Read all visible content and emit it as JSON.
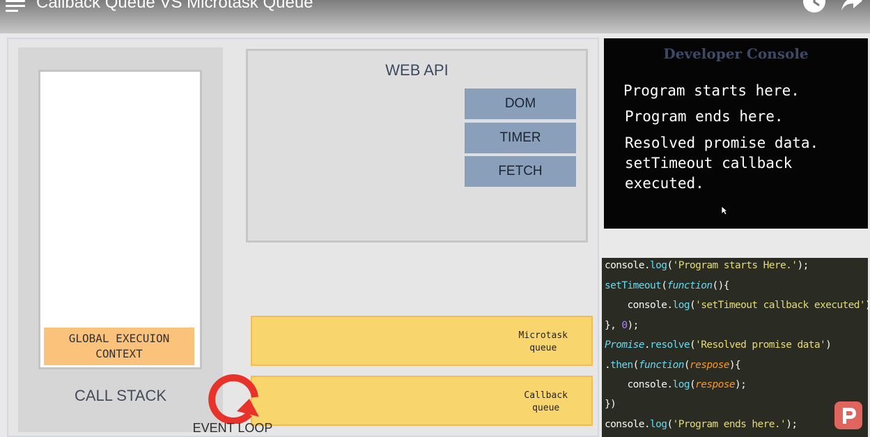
{
  "video": {
    "title": "Callback Queue VS Microtask Queue"
  },
  "call_stack": {
    "frame": [
      "GLOBAL EXECUION",
      "CONTEXT"
    ],
    "label": "CALL STACK"
  },
  "web_api": {
    "title": "WEB API",
    "buttons": [
      "DOM",
      "TIMER",
      "FETCH"
    ]
  },
  "queues": {
    "microtask": [
      "Microtask",
      "queue"
    ],
    "callback": [
      "Callback",
      "queue"
    ]
  },
  "event_loop": {
    "label": "EVENT LOOP",
    "color": "#e8332a"
  },
  "console": {
    "title": "Developer Console",
    "lines": [
      "Program starts here.",
      "Program ends here.",
      "Resolved promise data.",
      "setTimeout callback",
      "executed."
    ]
  },
  "code": {
    "lines": [
      [
        [
          "c-plain",
          "console."
        ],
        [
          "c-fn",
          "log"
        ],
        [
          "c-plain",
          "("
        ],
        [
          "c-str",
          "'Program starts Here.'"
        ],
        [
          "c-plain",
          ");"
        ]
      ],
      [
        [
          "c-fn",
          "setTimeout"
        ],
        [
          "c-plain",
          "("
        ],
        [
          "c-kw",
          "function"
        ],
        [
          "c-plain",
          "(){"
        ]
      ],
      [
        [
          "c-plain",
          "    console."
        ],
        [
          "c-fn",
          "log"
        ],
        [
          "c-plain",
          "("
        ],
        [
          "c-str",
          "'setTimeout callback executed'"
        ],
        [
          "c-plain",
          ");"
        ]
      ],
      [
        [
          "c-plain",
          "}, "
        ],
        [
          "c-num",
          "0"
        ],
        [
          "c-plain",
          ");"
        ]
      ],
      [
        [
          "c-kw",
          "Promise"
        ],
        [
          "c-plain",
          "."
        ],
        [
          "c-fn",
          "resolve"
        ],
        [
          "c-plain",
          "("
        ],
        [
          "c-str",
          "'Resolved promise data'"
        ],
        [
          "c-plain",
          ")"
        ]
      ],
      [
        [
          "c-plain",
          "."
        ],
        [
          "c-fn",
          "then"
        ],
        [
          "c-plain",
          "("
        ],
        [
          "c-kw",
          "function"
        ],
        [
          "c-plain",
          "("
        ],
        [
          "c-arg",
          "respose"
        ],
        [
          "c-plain",
          "){"
        ]
      ],
      [
        [
          "c-plain",
          "    console."
        ],
        [
          "c-fn",
          "log"
        ],
        [
          "c-plain",
          "("
        ],
        [
          "c-arg",
          "respose"
        ],
        [
          "c-plain",
          ");"
        ]
      ],
      [
        [
          "c-plain",
          "})"
        ]
      ],
      [
        [
          "c-plain",
          "console."
        ],
        [
          "c-fn",
          "log"
        ],
        [
          "c-plain",
          "("
        ],
        [
          "c-str",
          "'Program ends here.'"
        ],
        [
          "c-plain",
          ");"
        ]
      ]
    ]
  },
  "colors": {
    "microtask_queue": "#f9d56e",
    "web_api_button": "#8aa0ba",
    "global_context": "#fac27b",
    "logo": "#e0655e"
  }
}
